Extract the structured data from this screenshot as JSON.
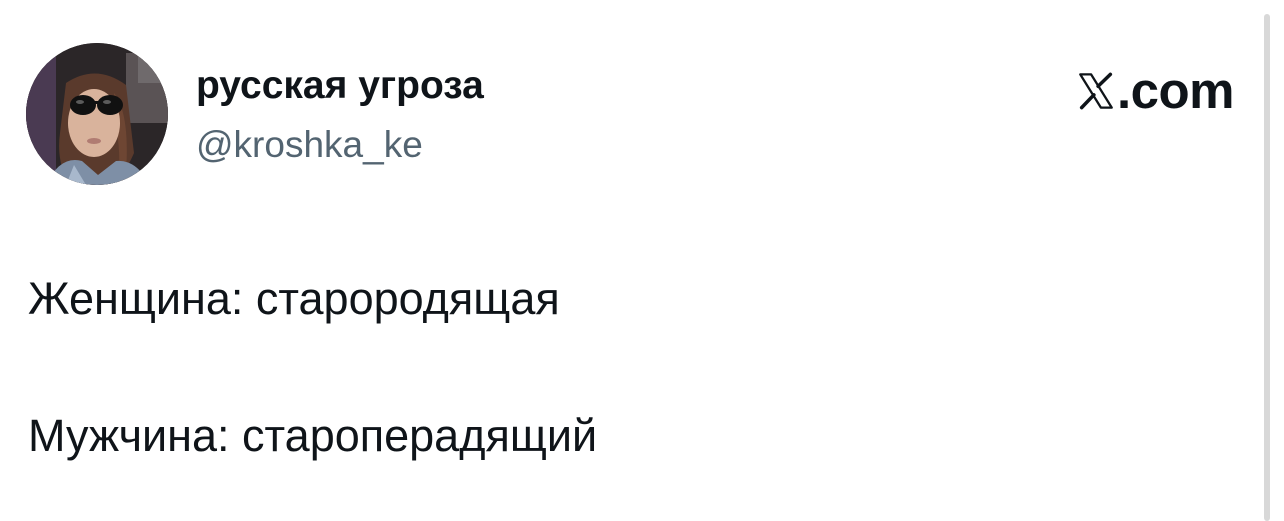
{
  "author": {
    "display_name": "русская угроза",
    "handle": "@kroshka_ke",
    "avatar_icon": "profile-photo"
  },
  "brand": {
    "logo_icon": "x-logo-icon",
    "domain": ".com"
  },
  "tweet": {
    "lines": [
      "Женщина: старородящая",
      "Мужчина: староперадящий"
    ]
  },
  "colors": {
    "text_primary": "#0f1419",
    "text_secondary": "#536471",
    "background": "#ffffff"
  }
}
